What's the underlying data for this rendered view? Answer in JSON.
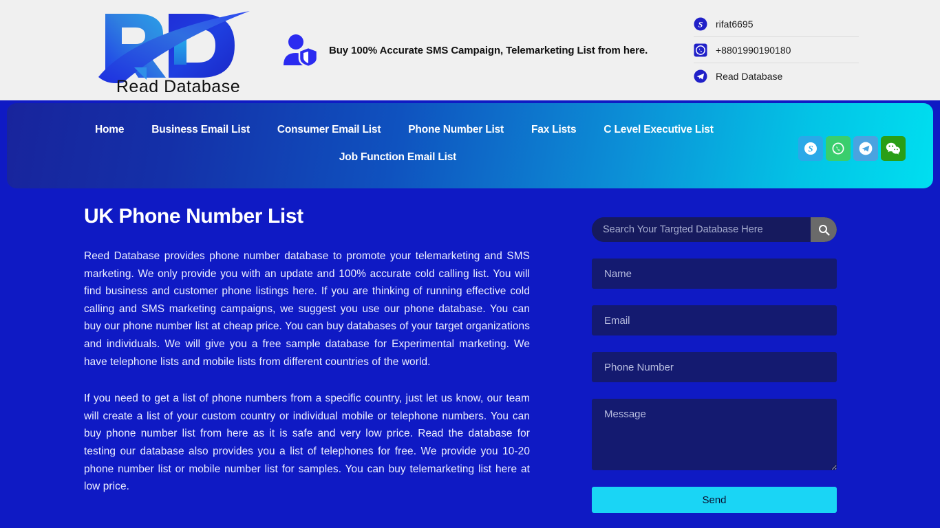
{
  "header": {
    "logo": {
      "mark": "RD",
      "wordmark": "Read Database",
      "icon_name": "read-database-logo"
    },
    "tagline": {
      "icon_name": "user-shield-icon",
      "text": "Buy 100% Accurate SMS Campaign, Telemarketing List from here."
    },
    "contacts": [
      {
        "icon_name": "skype-icon",
        "value": "rifat6695"
      },
      {
        "icon_name": "whatsapp-icon",
        "value": "+8801990190180"
      },
      {
        "icon_name": "telegram-icon",
        "value": "Read Database"
      }
    ]
  },
  "nav": {
    "items_row1": [
      "Home",
      "Business Email List",
      "Consumer Email List",
      "Phone Number List",
      "Fax Lists",
      "C Level Executive List"
    ],
    "items_row2": [
      "Job Function Email List"
    ],
    "social": [
      {
        "icon_name": "skype-icon",
        "label": "Skype"
      },
      {
        "icon_name": "whatsapp-icon",
        "label": "WhatsApp"
      },
      {
        "icon_name": "telegram-icon",
        "label": "Telegram"
      },
      {
        "icon_name": "wechat-icon",
        "label": "WeChat"
      }
    ],
    "colors": {
      "gradient_start": "#18249c",
      "gradient_end": "#00dff0"
    }
  },
  "main": {
    "title": "UK Phone Number List",
    "paragraphs": [
      "Reed Database provides phone number database to promote your telemarketing and SMS marketing. We only provide you with an update and 100% accurate cold calling list. You will find business and customer phone listings here. If you are thinking of running effective cold calling and SMS marketing campaigns, we suggest you use our phone database. You can buy our phone number list at cheap price. You can buy databases of your target organizations and individuals. We will give you a free sample database for Experimental marketing. We have telephone lists and mobile lists from different countries of the world.",
      "If you need to get a list of phone numbers from a specific country, just let us know, our team will create a list of your custom country or individual mobile or telephone numbers. You can buy phone number list from here as it is safe and very low price. Read the database for testing our database also provides you a list of telephones for free. We provide you 10-20 phone number list or mobile number list for samples. You can buy telemarketing list here at low price."
    ]
  },
  "sidebar": {
    "search": {
      "placeholder": "Search Your Targted Database Here",
      "value": "",
      "button_icon": "search-icon"
    },
    "form": {
      "name": {
        "placeholder": "Name",
        "value": ""
      },
      "email": {
        "placeholder": "Email",
        "value": ""
      },
      "phone": {
        "placeholder": "Phone Number",
        "value": ""
      },
      "message": {
        "placeholder": "Message",
        "value": ""
      },
      "submit_label": "Send"
    }
  },
  "colors": {
    "page_background": "#0f1ac4",
    "header_background": "#f0f0f0",
    "field_background": "#141a70",
    "send_button": "#1ad5f5",
    "search_button": "#6a6a6a"
  }
}
